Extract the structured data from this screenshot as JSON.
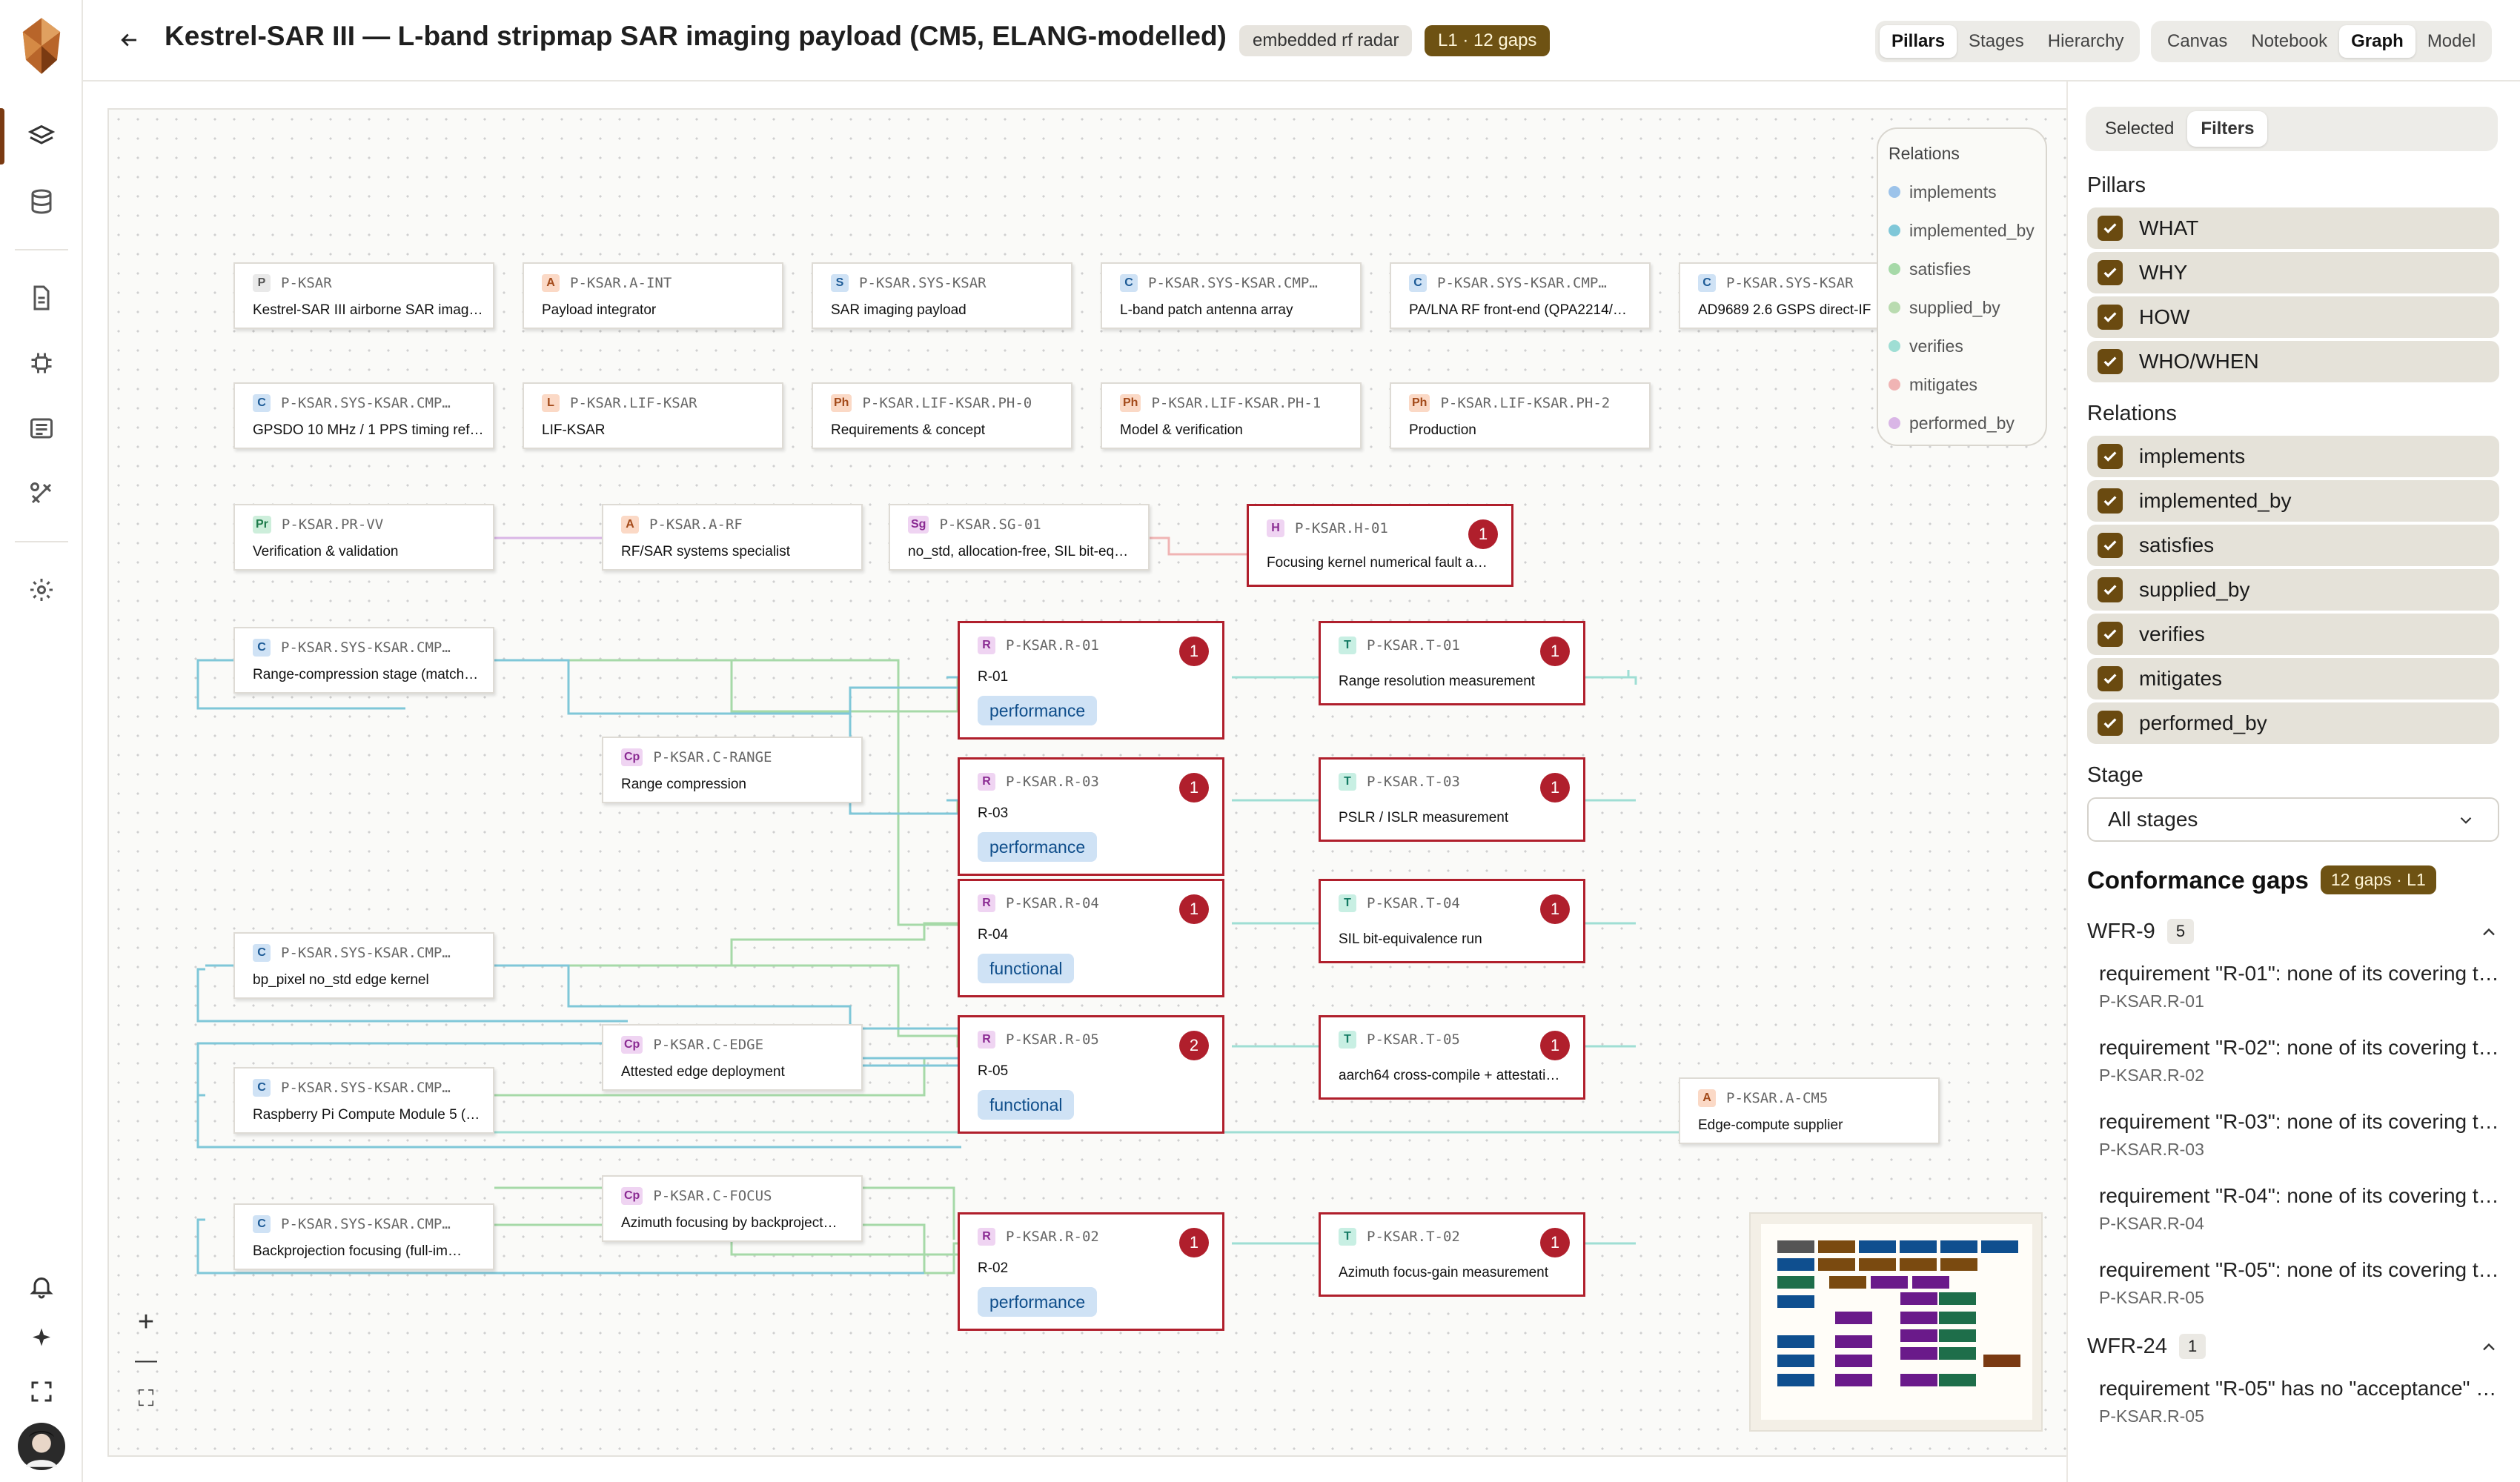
{
  "header": {
    "title": "Kestrel-SAR III — L-band stripmap SAR imaging payload (CM5, ELANG-modelled)",
    "tag": "embedded rf radar",
    "gaps_badge": "L1 · 12 gaps",
    "view_tabs": [
      "Pillars",
      "Stages",
      "Hierarchy"
    ],
    "view_active": "Pillars",
    "mode_tabs": [
      "Canvas",
      "Notebook",
      "Graph",
      "Model"
    ],
    "mode_active": "Graph"
  },
  "rail": {
    "icons": [
      "logo-icon",
      "layers-icon",
      "database-icon",
      "document-icon",
      "chip-icon",
      "list-icon",
      "tools-icon",
      "settings-icon",
      "bell-icon",
      "sparkle-icon",
      "expand-icon",
      "avatar"
    ]
  },
  "legend": {
    "title": "Relations",
    "items": [
      {
        "label": "implements",
        "color": "#9cc3ea"
      },
      {
        "label": "implemented_by",
        "color": "#7fc7d8"
      },
      {
        "label": "satisfies",
        "color": "#a6d9a8"
      },
      {
        "label": "supplied_by",
        "color": "#b9dbb0"
      },
      {
        "label": "verifies",
        "color": "#9fded4"
      },
      {
        "label": "mitigates",
        "color": "#f0b4b4"
      },
      {
        "label": "performed_by",
        "color": "#d9b6e6"
      }
    ]
  },
  "nodes": [
    {
      "badge": "P",
      "id": "P-KSAR",
      "name": "Kestrel-SAR III airborne SAR imag…"
    },
    {
      "badge": "A",
      "id": "P-KSAR.A-INT",
      "name": "Payload integrator"
    },
    {
      "badge": "S",
      "id": "P-KSAR.SYS-KSAR",
      "name": "SAR imaging payload"
    },
    {
      "badge": "C",
      "id": "P-KSAR.SYS-KSAR.CMP…",
      "name": "L-band patch antenna array"
    },
    {
      "badge": "C",
      "id": "P-KSAR.SYS-KSAR.CMP…",
      "name": "PA/LNA RF front-end (QPA2214/…"
    },
    {
      "badge": "C",
      "id": "P-KSAR.SYS-KSAR",
      "name": "AD9689 2.6 GSPS direct-IF"
    },
    {
      "badge": "C",
      "id": "P-KSAR.SYS-KSAR.CMP…",
      "name": "GPSDO 10 MHz / 1 PPS timing ref…"
    },
    {
      "badge": "L",
      "id": "P-KSAR.LIF-KSAR",
      "name": "LIF-KSAR"
    },
    {
      "badge": "Ph",
      "id": "P-KSAR.LIF-KSAR.PH-0",
      "name": "Requirements & concept"
    },
    {
      "badge": "Ph",
      "id": "P-KSAR.LIF-KSAR.PH-1",
      "name": "Model & verification"
    },
    {
      "badge": "Ph",
      "id": "P-KSAR.LIF-KSAR.PH-2",
      "name": "Production"
    },
    {
      "badge": "Pr",
      "id": "P-KSAR.PR-VV",
      "name": "Verification & validation"
    },
    {
      "badge": "A",
      "id": "P-KSAR.A-RF",
      "name": "RF/SAR systems specialist"
    },
    {
      "badge": "Sg",
      "id": "P-KSAR.SG-01",
      "name": "no_std, allocation-free, SIL bit-eq…"
    },
    {
      "badge": "H",
      "id": "P-KSAR.H-01",
      "name": "Focusing kernel numerical fault a…",
      "count": "1"
    },
    {
      "badge": "C",
      "id": "P-KSAR.SYS-KSAR.CMP…",
      "name": "Range-compression stage (match…"
    },
    {
      "badge": "Cp",
      "id": "P-KSAR.C-RANGE",
      "name": "Range compression"
    },
    {
      "badge": "C",
      "id": "P-KSAR.SYS-KSAR.CMP…",
      "name": "bp_pixel no_std edge kernel"
    },
    {
      "badge": "Cp",
      "id": "P-KSAR.C-EDGE",
      "name": "Attested edge deployment"
    },
    {
      "badge": "C",
      "id": "P-KSAR.SYS-KSAR.CMP…",
      "name": "Raspberry Pi Compute Module 5 (…"
    },
    {
      "badge": "Cp",
      "id": "P-KSAR.C-FOCUS",
      "name": "Azimuth focusing by backproject…"
    },
    {
      "badge": "C",
      "id": "P-KSAR.SYS-KSAR.CMP…",
      "name": "Backprojection focusing (full-im…"
    },
    {
      "badge": "A",
      "id": "P-KSAR.A-CM5",
      "name": "Edge-compute supplier"
    },
    {
      "badge": "R",
      "id": "P-KSAR.R-01",
      "name": "R-01",
      "count": "1",
      "tag": "performance"
    },
    {
      "badge": "R",
      "id": "P-KSAR.R-03",
      "name": "R-03",
      "count": "1",
      "tag": "performance"
    },
    {
      "badge": "R",
      "id": "P-KSAR.R-04",
      "name": "R-04",
      "count": "1",
      "tag": "functional"
    },
    {
      "badge": "R",
      "id": "P-KSAR.R-05",
      "name": "R-05",
      "count": "2",
      "tag": "functional"
    },
    {
      "badge": "R",
      "id": "P-KSAR.R-02",
      "name": "R-02",
      "count": "1",
      "tag": "performance"
    },
    {
      "badge": "T",
      "id": "P-KSAR.T-01",
      "name": "Range resolution measurement",
      "count": "1"
    },
    {
      "badge": "T",
      "id": "P-KSAR.T-03",
      "name": "PSLR / ISLR measurement",
      "count": "1"
    },
    {
      "badge": "T",
      "id": "P-KSAR.T-04",
      "name": "SIL bit-equivalence run",
      "count": "1"
    },
    {
      "badge": "T",
      "id": "P-KSAR.T-05",
      "name": "aarch64 cross-compile + attestati…",
      "count": "1"
    },
    {
      "badge": "T",
      "id": "P-KSAR.T-02",
      "name": "Azimuth focus-gain measurement",
      "count": "1"
    }
  ],
  "zoom": {
    "in": "+",
    "out": "—",
    "fit": "⛶"
  },
  "sidebar": {
    "tabs": [
      "Selected",
      "Filters"
    ],
    "tab_active": "Filters",
    "pillars_heading": "Pillars",
    "pillars": [
      "WHAT",
      "WHY",
      "HOW",
      "WHO/WHEN"
    ],
    "relations_heading": "Relations",
    "relations": [
      "implements",
      "implemented_by",
      "satisfies",
      "supplied_by",
      "verifies",
      "mitigates",
      "performed_by"
    ],
    "stage_heading": "Stage",
    "stage_value": "All stages",
    "conformance_heading": "Conformance gaps",
    "conformance_badge": "12 gaps · L1",
    "groups": [
      {
        "name": "WFR-9",
        "count": "5",
        "items": [
          {
            "text": "requirement \"R-01\": none of its covering t…",
            "ref": "P-KSAR.R-01"
          },
          {
            "text": "requirement \"R-02\": none of its covering t…",
            "ref": "P-KSAR.R-02"
          },
          {
            "text": "requirement \"R-03\": none of its covering t…",
            "ref": "P-KSAR.R-03"
          },
          {
            "text": "requirement \"R-04\": none of its covering t…",
            "ref": "P-KSAR.R-04"
          },
          {
            "text": "requirement \"R-05\": none of its covering t…",
            "ref": "P-KSAR.R-05"
          }
        ]
      },
      {
        "name": "WFR-24",
        "count": "1",
        "items": [
          {
            "text": "requirement \"R-05\" has no \"acceptance\" …",
            "ref": "P-KSAR.R-05"
          }
        ]
      }
    ]
  },
  "colors": {
    "accent": "#6e5213",
    "gap_red": "#b01f2c",
    "tag_blue": "#cfe2f5",
    "checkbox": "#6a4a10"
  }
}
